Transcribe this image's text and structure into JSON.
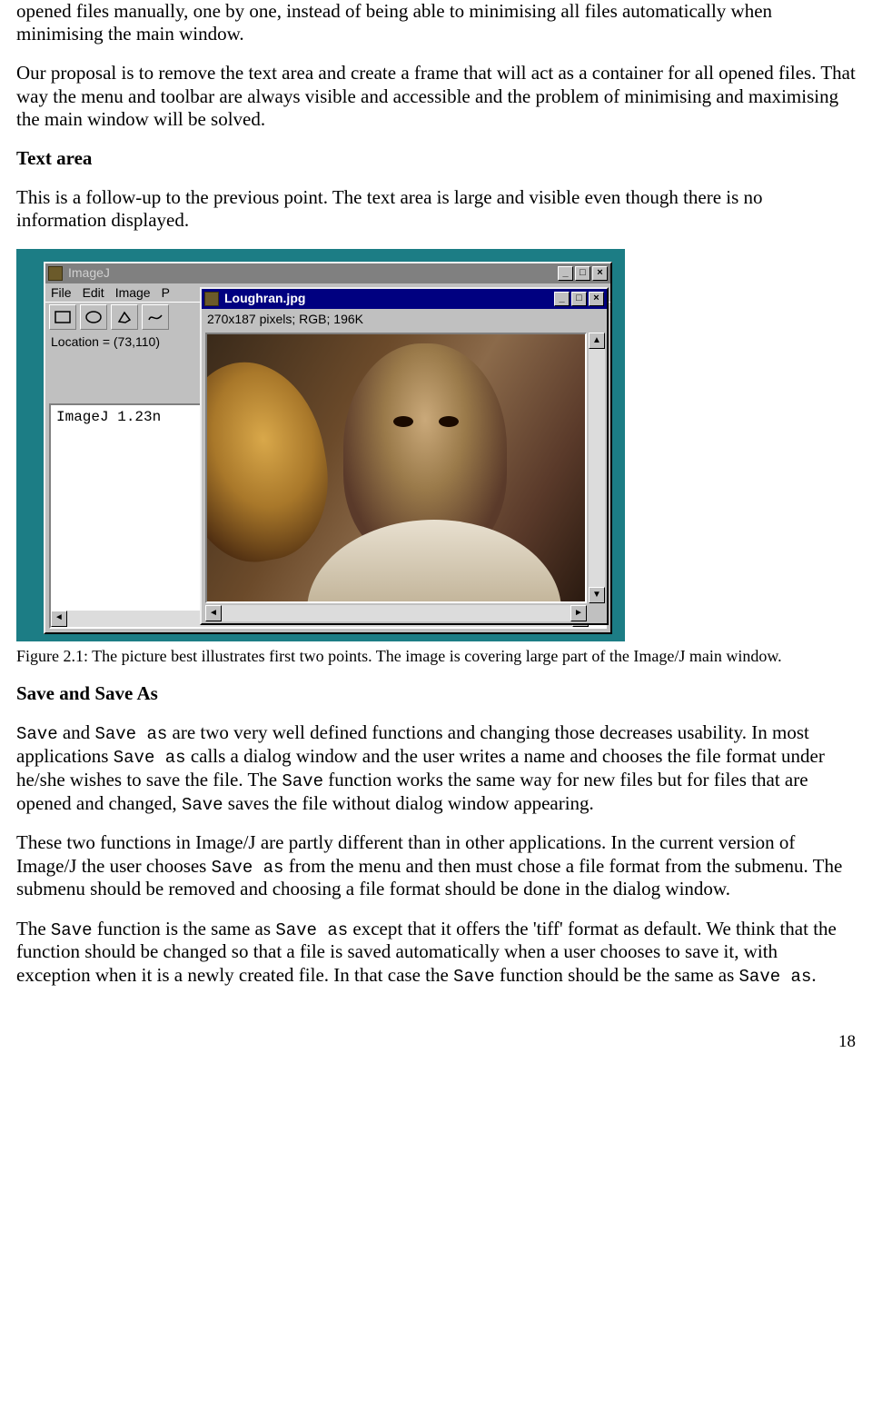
{
  "para_intro": "opened files manually, one by one, instead of being able to minimising all files automatically when minimising the main window.",
  "para_proposal": "Our proposal is to remove the text area and create a frame that will act as a container for all opened files. That way the menu and toolbar are always visible and accessible and the problem of minimising and maximising the main window will be solved.",
  "heading_textarea": "Text area",
  "para_textarea": "This is a follow-up to the previous point. The text area is large and visible even though there is no information displayed.",
  "figure": {
    "bg_title": "ImageJ",
    "menu": [
      "File",
      "Edit",
      "Image",
      "P"
    ],
    "status_location": "Location = (73,110)",
    "textarea_content": "ImageJ 1.23n",
    "fg_title": "Loughran.jpg",
    "fg_info": "270x187 pixels; RGB; 196K",
    "winbtn_min": "_",
    "winbtn_max": "□",
    "winbtn_close": "×",
    "arrow_up": "▲",
    "arrow_down": "▼",
    "arrow_left": "◄",
    "arrow_right": "►"
  },
  "caption": "Figure 2.1: The picture best illustrates first two points. The image is covering large part of the Image/J main window.",
  "heading_save": "Save and Save As",
  "p_save1_pre": " and ",
  "p_save1_post": " are two very well defined functions and changing those decreases usability. In most applications ",
  "p_save1_post2": " calls a dialog window and the user writes a name and chooses the file format under he/she wishes to save the file. The ",
  "p_save1_post3": " function works the same way for new files but for files that are opened and changed, ",
  "p_save1_post4": " saves the file without dialog window appearing.",
  "p_save2_a": "These two functions in Image/J are partly different than in other applications. In the current version of Image/J the user chooses ",
  "p_save2_b": " from the menu and then must chose a file format from the submenu. The submenu should be removed and choosing a file format should be done in the dialog window.",
  "p_save3_a": "The ",
  "p_save3_b": " function is the same as ",
  "p_save3_c": " except that it offers the 'tiff' format as default. We think that the function should be changed so that a file is saved automatically when a user chooses to save it, with exception when it is a newly created file. In that case the ",
  "p_save3_d": " function should be the same as ",
  "p_save3_e": ".",
  "tok_Save": "Save",
  "tok_Save_as": "Save as",
  "pagenum": "18"
}
